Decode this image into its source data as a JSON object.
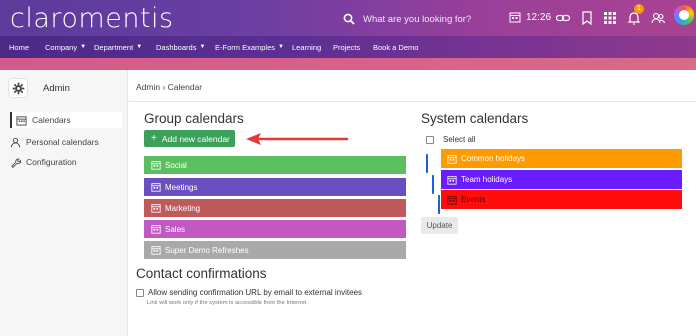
{
  "header": {
    "logo_text": "claromentis",
    "search_placeholder": "What are you looking for?",
    "time": "12:26",
    "notification_count": "1",
    "icons": [
      "search-icon",
      "calendar-icon",
      "link-icon",
      "bookmark-icon",
      "apps-grid-icon",
      "bell-icon",
      "people-icon",
      "avatar"
    ]
  },
  "nav": {
    "items": [
      {
        "label": "Home",
        "dropdown": false
      },
      {
        "label": "Company",
        "dropdown": true
      },
      {
        "label": "Department",
        "dropdown": true
      },
      {
        "label": "Dashboards",
        "dropdown": true
      },
      {
        "label": "E-Form Examples",
        "dropdown": true
      },
      {
        "label": "Learning",
        "dropdown": false
      },
      {
        "label": "Projects",
        "dropdown": false
      },
      {
        "label": "Book a Demo",
        "dropdown": false
      }
    ]
  },
  "sidebar": {
    "title": "Admin",
    "items": [
      {
        "label": "Calendars",
        "icon": "calendar-icon",
        "active": true
      },
      {
        "label": "Personal calendars",
        "icon": "person-icon",
        "active": false
      },
      {
        "label": "Configuration",
        "icon": "wrench-icon",
        "active": false
      }
    ]
  },
  "breadcrumb": "Admin › Calendar",
  "group_calendars": {
    "heading": "Group calendars",
    "add_button": "Add new calendar",
    "items": [
      {
        "label": "Social",
        "color": "#5cbf5f"
      },
      {
        "label": "Meetings",
        "color": "#6b4fc1"
      },
      {
        "label": "Marketing",
        "color": "#bf5a5a"
      },
      {
        "label": "Sales",
        "color": "#c259c2"
      },
      {
        "label": "Super Demo Refreshes",
        "color": "#a9a9a9"
      }
    ]
  },
  "contact": {
    "heading": "Contact confirmations",
    "checkbox_label": "Allow sending confirmation URL by email to external invitees",
    "checked": false,
    "note": "Link will work only if the system is accessible from the Internet."
  },
  "system_calendars": {
    "heading": "System calendars",
    "select_all_label": "Select all",
    "select_all_checked": false,
    "items": [
      {
        "label": "Common holidays",
        "color": "#ff9a00",
        "text_color": "#ffffff",
        "checked": true
      },
      {
        "label": "Team holidays",
        "color": "#6a1cff",
        "text_color": "#ffffff",
        "checked": true
      },
      {
        "label": "Events",
        "color": "#ff0d0d",
        "text_color": "#5a0a0a",
        "checked": true
      }
    ],
    "update_button": "Update"
  },
  "colors": {
    "accent_green": "#3aa05a",
    "arrow_red": "#e53935",
    "checkbox_blue": "#1565d8"
  }
}
